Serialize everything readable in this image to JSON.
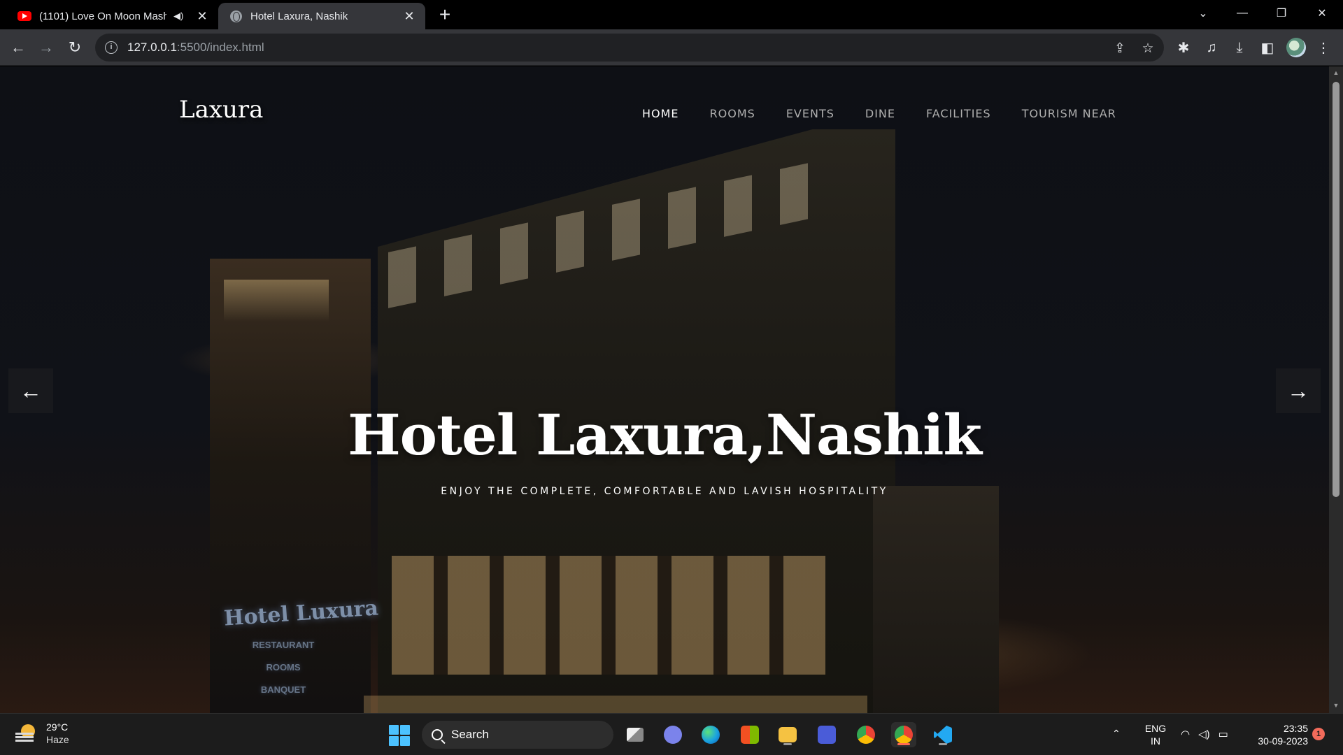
{
  "browser": {
    "tabs": [
      {
        "title": "(1101) Love On Moon Mash",
        "icon": "youtube-icon",
        "audio": true,
        "active": false
      },
      {
        "title": "Hotel Laxura, Nashik",
        "icon": "globe-icon",
        "active": true
      }
    ],
    "address": {
      "host": "127.0.0.1",
      "path": ":5500/index.html"
    }
  },
  "site": {
    "logo": "Laxura",
    "nav": [
      "HOME",
      "ROOMS",
      "EVENTS",
      "DINE",
      "FACILITIES",
      "TOURISM NEAR"
    ],
    "active_nav": "HOME",
    "hero": {
      "title": "Hotel Laxura,Nashik",
      "subtitle": "ENJOY THE COMPLETE, COMFORTABLE AND LAVISH HOSPITALITY"
    },
    "building_sign": {
      "name": "Hotel Luxura",
      "lines": [
        "RESTAURANT",
        "ROOMS",
        "BANQUET"
      ]
    }
  },
  "taskbar": {
    "weather": {
      "temp": "29°C",
      "condition": "Haze"
    },
    "search_label": "Search",
    "language": [
      "ENG",
      "IN"
    ],
    "time": "23:35",
    "date": "30-09-2023",
    "notification_count": "1"
  }
}
